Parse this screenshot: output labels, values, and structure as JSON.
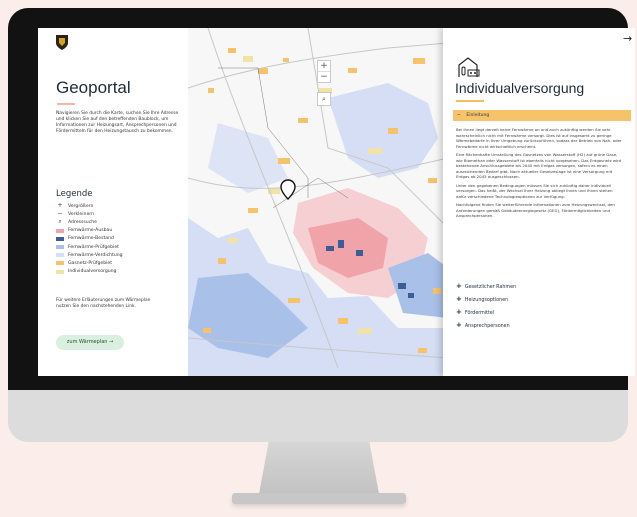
{
  "left_panel": {
    "title": "Geoportal",
    "intro": "Navigieren Sie durch die Karte, suchen Sie Ihre Adresse und klicken Sie auf den betreffenden Baublock, um Informationen zur Heizungsart, Ansprechpersonen und Fördermitteln für den Heizungstausch zu bekommen.",
    "legend_title": "Legende",
    "legend": [
      {
        "label": "Vergrößern",
        "symbol": "+"
      },
      {
        "label": "Verkleinern",
        "symbol": "−"
      },
      {
        "label": "Adresssuche",
        "symbol": "⌕"
      },
      {
        "label": "Fernwärme-Ausbau",
        "color": "#f0a3a9"
      },
      {
        "label": "Fernwärme-Bestand",
        "color": "#3e5c96"
      },
      {
        "label": "Fernwärme-Prüfgebiet",
        "color": "#a9c0e8"
      },
      {
        "label": "Fernwärme-Verdichtung",
        "color": "#d5def4"
      },
      {
        "label": "Gasnetz-Prüfgebiet",
        "color": "#f6c36a"
      },
      {
        "label": "Individualversorgung",
        "color": "#f0e3a5"
      }
    ],
    "more_text": "Für weitere Erläuterungen zum Wärmeplan nutzen Sie den nachstehenden Link.",
    "button_label": "zum Wärmeplan →"
  },
  "map": {
    "zoom_in": "+",
    "zoom_out": "−",
    "search_icon": "search-icon"
  },
  "right_panel": {
    "back_arrow": "→",
    "title": "Individualversorgung",
    "section_open": "Einleitung",
    "body": [
      "Bei Ihnen liegt derzeit keine Fernwärme an und auch zukünftig werden Sie sehr wahrscheinlich nicht mit Fernwärme versorgt. Dies ist auf insgesamt zu geringe Wärmebedarfe in Ihrer Umgebung zurückzuführen, sodass der Betrieb von Nah- oder Fernwärme nicht wirtschaftlich erscheint.",
      "Eine flächenhafte Umstellung des Gasnetzes von Wasserstoff (H2) auf grüne Gase, wie Biomethan oder Wasserstoff ist ebenfalls nicht vorgesehen. Das Erdgasnetz wird bestehende Anschlussgebiete bis 2045 mit Erdgas versorgen, sofern es einen ausreichenden Bedarf gibt. Nach aktueller Gesetzeslage ist eine Versorgung mit Erdgas ab 2045 ausgeschlossen.",
      "Unter den gegebenen Bedingungen müssen Sie sich zukünftig daher individuell versorgen. Das heißt, der Wechsel Ihrer Heizung obliegt Ihnen und Ihnen stehen dafür verschiedene Technologieoptionen zur Verfügung.",
      "Nachfolgend finden Sie weiterführende Informationen zum Heizungswechsel, den Anforderungen gemäß Gebäudeenergiegesetz (GEG), Fördermöglichkeiten und Ansprechpersonen."
    ],
    "sections": [
      "Gesetzlicher Rahmen",
      "Heizungsoptionen",
      "Fördermittel",
      "Ansprechpersonen"
    ]
  },
  "colors": {
    "fernwaerme_ausbau": "#f0a3a9",
    "fernwaerme_bestand": "#3e5c96",
    "fernwaerme_pruefgebiet": "#a9c0e8",
    "gasnetz_pruefgebiet": "#f6c36a",
    "accent_green": "#d9efdf"
  }
}
